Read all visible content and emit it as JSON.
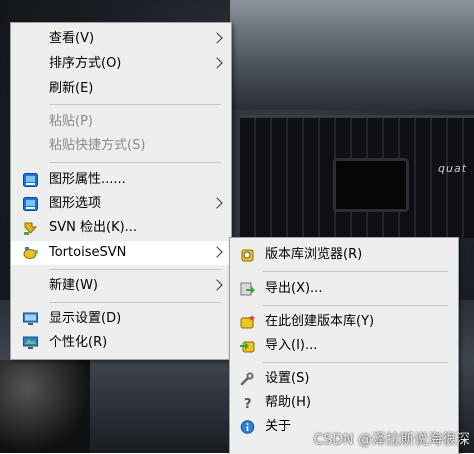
{
  "context_menu": {
    "items": [
      {
        "label": "查看(V)",
        "has_submenu": true,
        "disabled": false
      },
      {
        "label": "排序方式(O)",
        "has_submenu": true,
        "disabled": false
      },
      {
        "label": "刷新(E)",
        "has_submenu": false,
        "disabled": false
      },
      {
        "label": "粘贴(P)",
        "has_submenu": false,
        "disabled": true
      },
      {
        "label": "粘贴快捷方式(S)",
        "has_submenu": false,
        "disabled": true
      },
      {
        "label": "图形属性......",
        "icon": "intel-graphics-icon",
        "has_submenu": false
      },
      {
        "label": "图形选项",
        "icon": "intel-graphics-icon",
        "has_submenu": true
      },
      {
        "label": "SVN 检出(K)...",
        "icon": "svn-checkout-icon",
        "has_submenu": false
      },
      {
        "label": "TortoiseSVN",
        "icon": "tortoisesvn-icon",
        "has_submenu": true,
        "highlighted": true
      },
      {
        "label": "新建(W)",
        "has_submenu": true
      },
      {
        "label": "显示设置(D)",
        "icon": "display-settings-icon",
        "has_submenu": false
      },
      {
        "label": "个性化(R)",
        "icon": "personalize-icon",
        "has_submenu": false
      }
    ]
  },
  "tortoise_submenu": {
    "items": [
      {
        "label": "版本库浏览器(R)",
        "icon": "repo-browser-icon"
      },
      {
        "label": "导出(X)...",
        "icon": "export-icon"
      },
      {
        "label": "在此创建版本库(Y)",
        "icon": "create-repo-icon"
      },
      {
        "label": "导入(I)...",
        "icon": "import-icon"
      },
      {
        "label": "设置(S)",
        "icon": "settings-wrench-icon"
      },
      {
        "label": "帮助(H)",
        "icon": "help-icon"
      },
      {
        "label": "关于",
        "icon": "about-info-icon"
      }
    ]
  },
  "watermark": "CSDN @泽拉斯说海很深",
  "wallpaper_badge": "quat"
}
